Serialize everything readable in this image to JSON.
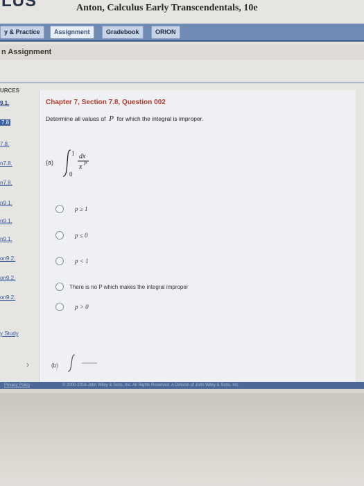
{
  "app": {
    "logo": "LUS",
    "book_title": "Anton, Calculus Early Transcendentals, 10e"
  },
  "nav": {
    "tabs": [
      {
        "label": "y & Practice"
      },
      {
        "label": "Assignment"
      },
      {
        "label": "Gradebook"
      },
      {
        "label": "ORION"
      }
    ]
  },
  "page": {
    "title": "n Assignment"
  },
  "sidebar": {
    "heading": "URCES",
    "items": [
      {
        "label": "9.1."
      },
      {
        "label": "7.8"
      },
      {
        "label": "7.8."
      },
      {
        "label": "n7.8."
      },
      {
        "label": "n7.8."
      },
      {
        "label": "n9.1."
      },
      {
        "label": "n9.1."
      },
      {
        "label": "n9.1."
      },
      {
        "label": "on9.2."
      },
      {
        "label": "on9.2."
      },
      {
        "label": "on9.2."
      }
    ],
    "study_link": "y Study"
  },
  "question": {
    "title": "Chapter 7, Section 7.8, Question 002",
    "prompt_before": "Determine all values of",
    "prompt_var": "P",
    "prompt_after": "for which the integral is improper.",
    "part_a_label": "(a)",
    "options": [
      {
        "label": "p ≥ 1"
      },
      {
        "label": "p ≤ 0"
      },
      {
        "label": "p < 1"
      },
      {
        "label": "There is no P which makes the integral improper"
      },
      {
        "label": "p > 0"
      }
    ],
    "part_b_label": "(b)"
  },
  "footer": {
    "privacy": "Privacy Policy",
    "copyright": "© 2000-2016 John Wiley & Sons, Inc. All Rights Reserved. A Division of John Wiley & Sons, Inc."
  }
}
